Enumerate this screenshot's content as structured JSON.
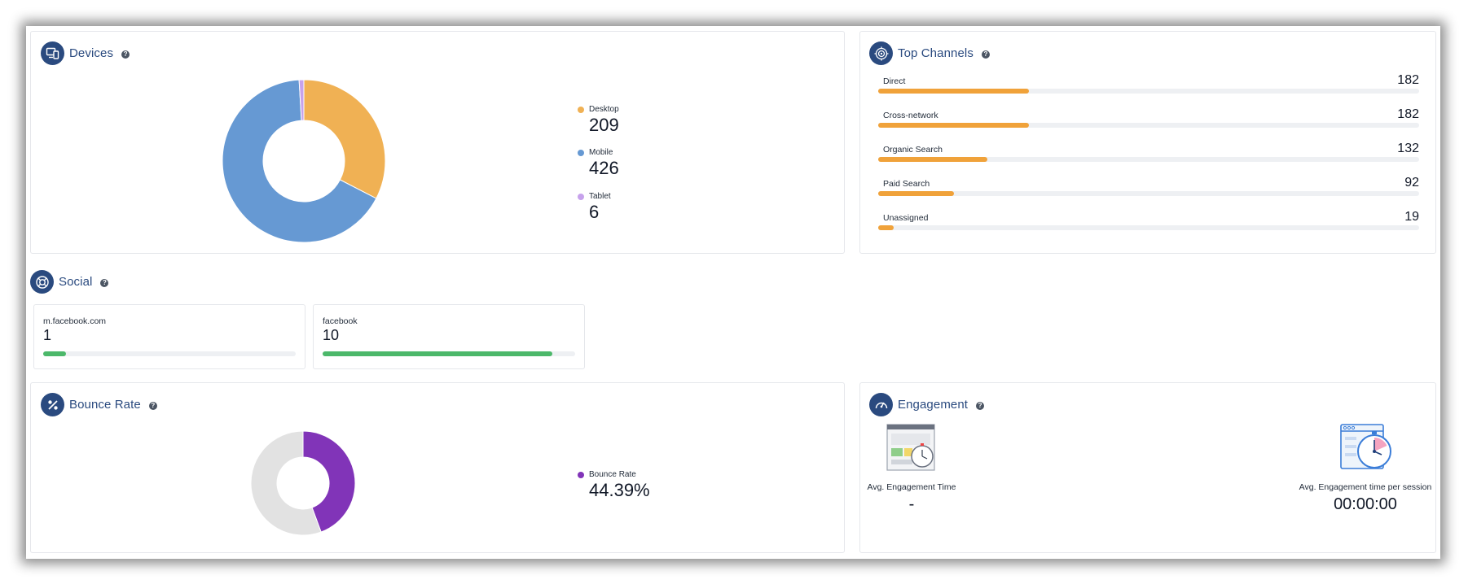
{
  "devices": {
    "title": "Devices",
    "help": "?",
    "legend": [
      {
        "label": "Desktop",
        "value": "209",
        "color": "#f0b154"
      },
      {
        "label": "Mobile",
        "value": "426",
        "color": "#6699d3"
      },
      {
        "label": "Tablet",
        "value": "6",
        "color": "#c7a2ec"
      }
    ]
  },
  "top_channels": {
    "title": "Top Channels",
    "help": "?",
    "max": 182,
    "scale_max": 655,
    "items": [
      {
        "label": "Direct",
        "value": "182",
        "num": 182
      },
      {
        "label": "Cross-network",
        "value": "182",
        "num": 182
      },
      {
        "label": "Organic Search",
        "value": "132",
        "num": 132
      },
      {
        "label": "Paid Search",
        "value": "92",
        "num": 92
      },
      {
        "label": "Unassigned",
        "value": "19",
        "num": 19
      }
    ]
  },
  "social": {
    "title": "Social",
    "help": "?",
    "scale_max": 11,
    "items": [
      {
        "label": "m.facebook.com",
        "value": "1",
        "num": 1
      },
      {
        "label": "facebook",
        "value": "10",
        "num": 10
      }
    ]
  },
  "bounce_rate": {
    "title": "Bounce Rate",
    "help": "?",
    "legend_label": "Bounce Rate",
    "value": "44.39%",
    "percent": 44.39,
    "color": "#8134b8",
    "rest_color": "#e2e2e2"
  },
  "engagement": {
    "title": "Engagement",
    "help": "?",
    "avg_time_label": "Avg. Engagement Time",
    "avg_time_value": "-",
    "per_session_label": "Avg. Engagement time per session",
    "per_session_value": "00:00:00"
  },
  "chart_data": [
    {
      "type": "pie",
      "categories": [
        "Desktop",
        "Mobile",
        "Tablet"
      ],
      "values": [
        209,
        426,
        6
      ]
    },
    {
      "type": "bar",
      "categories": [
        "Direct",
        "Cross-network",
        "Organic Search",
        "Paid Search",
        "Unassigned"
      ],
      "values": [
        182,
        182,
        132,
        92,
        19
      ]
    },
    {
      "type": "pie",
      "categories": [
        "Bounce Rate"
      ],
      "values": [
        44.39,
        55.61
      ]
    }
  ]
}
